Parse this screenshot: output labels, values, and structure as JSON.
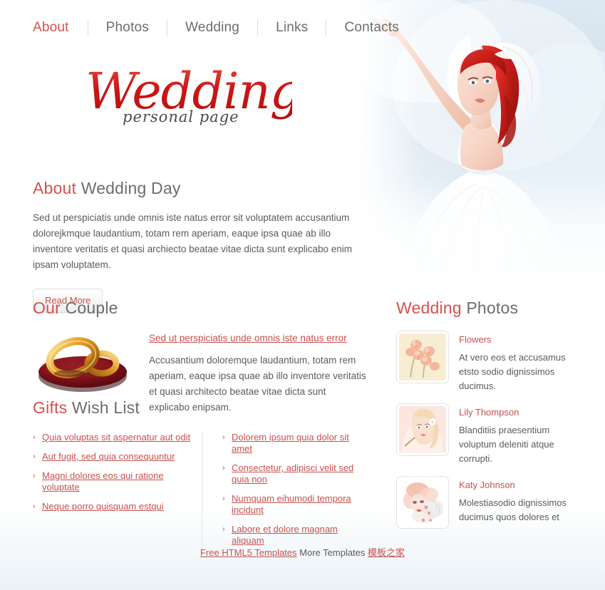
{
  "nav": {
    "items": [
      {
        "label": "About",
        "active": true
      },
      {
        "label": "Photos",
        "active": false
      },
      {
        "label": "Wedding",
        "active": false
      },
      {
        "label": "Links",
        "active": false
      },
      {
        "label": "Contacts",
        "active": false
      }
    ]
  },
  "logo": {
    "main": "Wedding",
    "sub": "personal page"
  },
  "about": {
    "heading_accent": "About",
    "heading_rest": " Wedding Day",
    "paragraph": "Sed ut perspiciatis unde omnis iste natus error sit voluptatem accusantium dolorejkmque laudantium, totam rem aperiam, eaque ipsa quae ab illo inventore veritatis et quasi archiecto beatae vitae dicta sunt explicabo enim ipsam voluptatem.",
    "read_more": "Read More"
  },
  "couple": {
    "heading_accent": "Our",
    "heading_rest": " Couple",
    "link": "Sed ut perspiciatis unde omnis iste natus error",
    "paragraph": "Accusantium doloremque laudantium, totam rem aperiam, eaque ipsa quae ab illo inventore veritatis et quasi architecto beatae vitae dicta sunt explicabo enipsam."
  },
  "gifts": {
    "heading_accent": "Gifts",
    "heading_rest": " Wish List",
    "bullet": "›",
    "left": [
      "Quia voluptas sit aspernatur aut odit",
      "Aut fugit, sed quia consequuntur",
      "Magni dolores eos qui ratione voluptate",
      "Neque porro quisquam estqui"
    ],
    "right": [
      "Dolorem ipsum quia dolor sit amet",
      "Consectetur, adipisci velit sed quia non",
      "Numquam eihumodi tempora incidunt",
      "Labore et dolore magnam aliquam"
    ]
  },
  "photos": {
    "heading_accent": "Wedding",
    "heading_rest": " Photos",
    "items": [
      {
        "thumb": "flowers-thumbnail",
        "title": "Flowers",
        "desc": "At vero eos et accusamus etsto sodio dignissimos ducimus."
      },
      {
        "thumb": "lily-thompson-thumbnail",
        "title": "Lily Thompson",
        "desc": "Blanditiis praesentium voluptum deleniti atque corrupti."
      },
      {
        "thumb": "katy-johnson-thumbnail",
        "title": "Katy Johnson",
        "desc": "Molestiasodio dignissimos ducimus quos dolores et"
      }
    ]
  },
  "footer": {
    "link1": "Free HTML5 Templates",
    "plain": " More Templates ",
    "link2": "模板之家"
  },
  "hero": {
    "alt": "bride-illustration"
  },
  "colors": {
    "accent_red": "#c8504d",
    "heading_gray": "#6d6d6d",
    "body_gray": "#5b5b5b",
    "logo_red": "#cc1616",
    "banner_blue": "#cfe0ec"
  }
}
